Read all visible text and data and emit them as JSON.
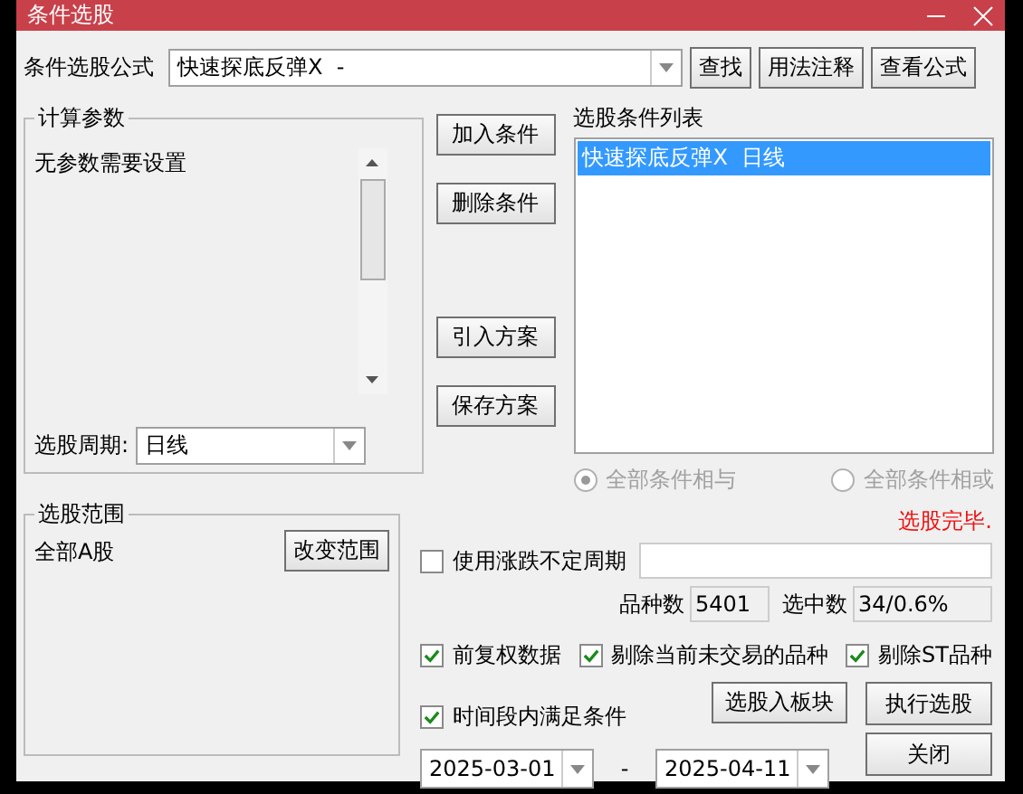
{
  "window": {
    "title": "条件选股"
  },
  "formula": {
    "label": "条件选股公式",
    "value": "快速探底反弹X  -",
    "buttons": [
      "查找",
      "用法注释",
      "查看公式"
    ]
  },
  "params": {
    "title": "计算参数",
    "text": "无参数需要设置",
    "period_label": "选股周期:",
    "period_value": "日线"
  },
  "side_buttons": [
    "加入条件",
    "删除条件",
    "引入方案",
    "保存方案"
  ],
  "conditions": {
    "title": "选股条件列表",
    "items": [
      {
        "label": "快速探底反弹X  日线",
        "selected": true
      }
    ]
  },
  "logic": [
    {
      "label": "全部条件相与",
      "selected": true
    },
    {
      "label": "全部条件相或",
      "selected": false
    }
  ],
  "range": {
    "title": "选股范围",
    "value": "全部A股",
    "button": "改变范围"
  },
  "status": "选股完毕.",
  "variable_period": {
    "label": "使用涨跌不定周期",
    "checked": false
  },
  "counts": [
    {
      "label": "品种数",
      "value": "5401"
    },
    {
      "label": "选中数",
      "value": "34/0.6%"
    }
  ],
  "options": [
    {
      "label": "前复权数据",
      "checked": true
    },
    {
      "label": "剔除当前未交易的品种",
      "checked": true
    },
    {
      "label": "剔除ST品种",
      "checked": true
    }
  ],
  "time_range": {
    "label": "时间段内满足条件",
    "checked": true,
    "start": "2025-03-01",
    "separator": "-",
    "end": "2025-04-11"
  },
  "actions": [
    "选股入板块",
    "执行选股",
    "关闭"
  ]
}
